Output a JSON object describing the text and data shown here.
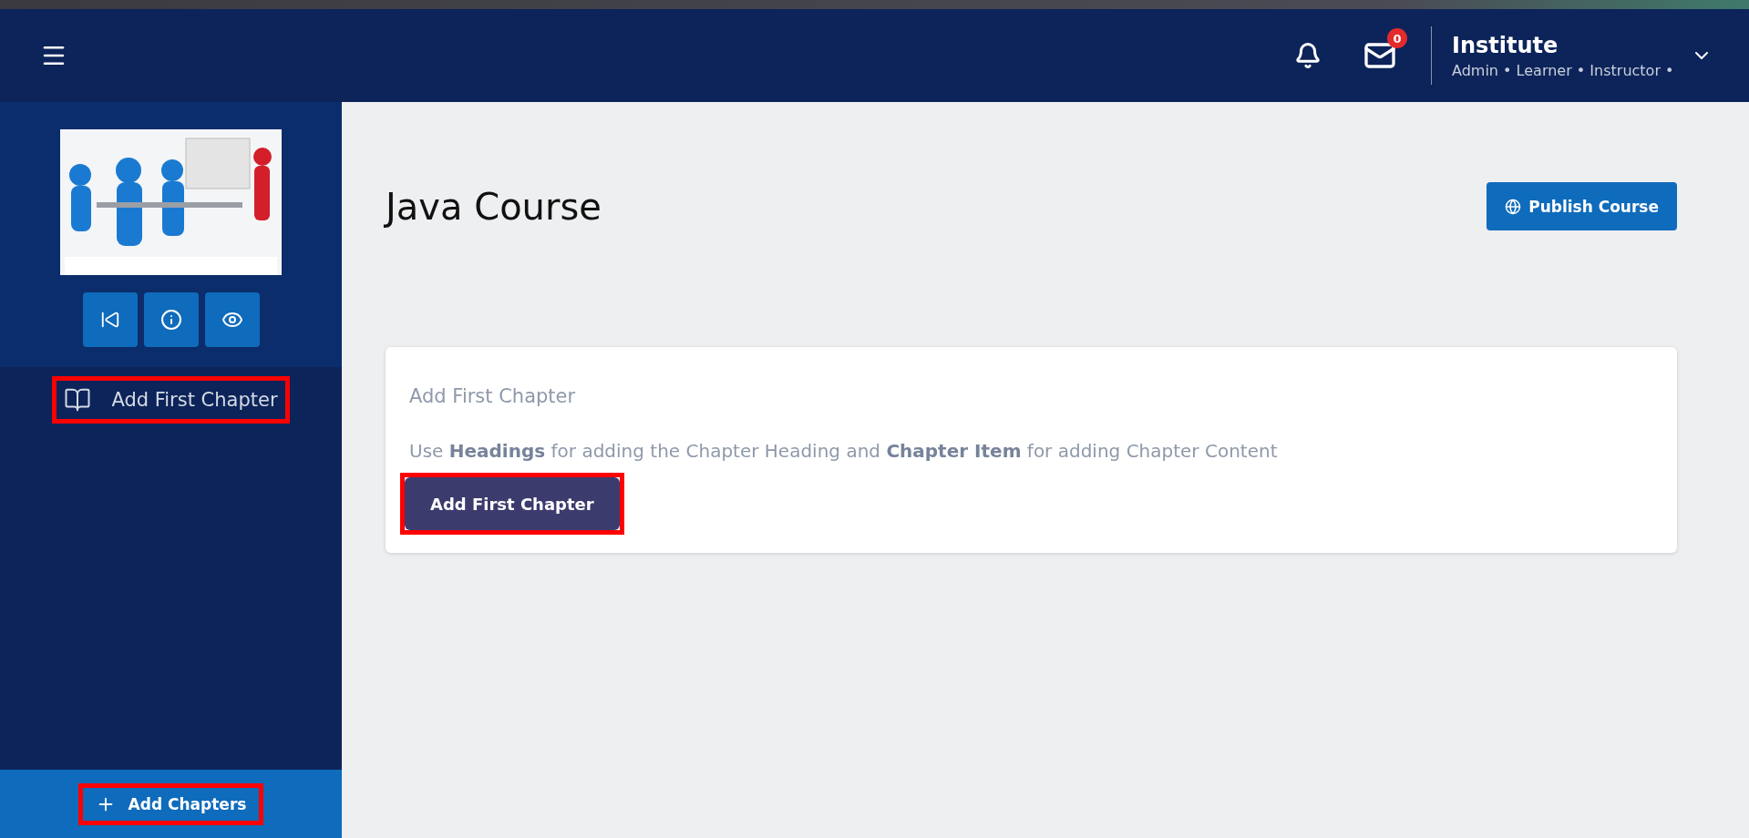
{
  "header": {
    "notifications": {
      "kind": "bell"
    },
    "messages": {
      "badge": "0"
    },
    "user": {
      "name": "Institute",
      "roles": "Admin • Learner • Instructor •"
    }
  },
  "sidebar": {
    "tools": [
      {
        "kind": "back"
      },
      {
        "kind": "info"
      },
      {
        "kind": "preview"
      }
    ],
    "chapters": [
      {
        "label": "Add First Chapter",
        "highlighted": true
      }
    ],
    "footer_button": {
      "label": "Add Chapters",
      "highlighted": true
    }
  },
  "main": {
    "title": "Java Course",
    "publish_button": "Publish Course",
    "card": {
      "heading": "Add First Chapter",
      "text": "Use **Headings** for adding the Chapter Heading and **Chapter Item** for adding Chapter Content",
      "button": {
        "label": "Add First Chapter",
        "highlighted": true
      }
    }
  }
}
